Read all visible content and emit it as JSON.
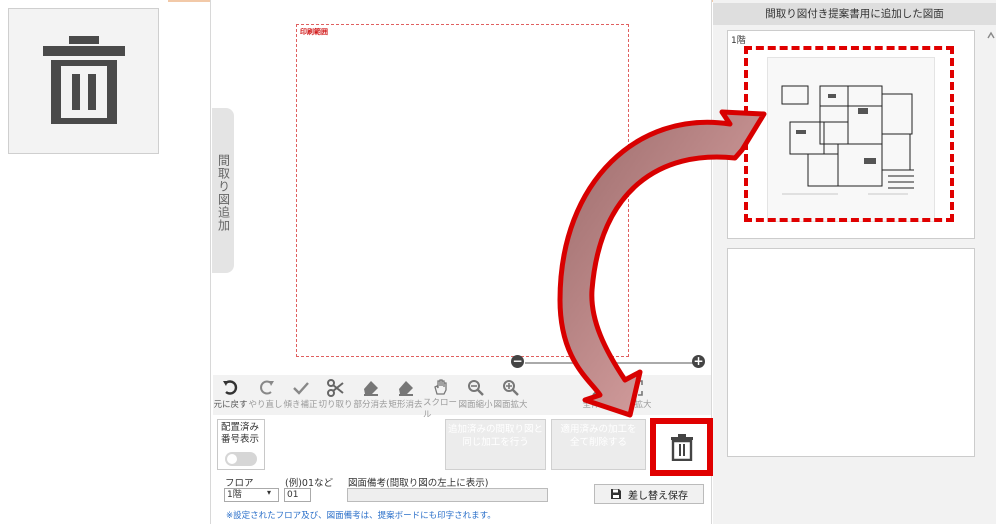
{
  "colors": {
    "highlight_red": "#e00000",
    "note_blue": "#2a6fc9",
    "print_red": "#d21a1a"
  },
  "side_tab": {
    "label": "間取り図追加"
  },
  "canvas": {
    "print_area_label": "印刷範囲"
  },
  "toolbar": {
    "items": [
      {
        "label": "元に戻す",
        "icon": "undo-icon"
      },
      {
        "label": "やり直し",
        "icon": "redo-icon"
      },
      {
        "label": "傾き補正",
        "icon": "check-icon"
      },
      {
        "label": "切り取り",
        "icon": "scissors-icon"
      },
      {
        "label": "部分消去",
        "icon": "eraser-icon"
      },
      {
        "label": "矩形消去",
        "icon": "rect-eraser-icon"
      },
      {
        "label": "スクロール",
        "icon": "hand-icon"
      },
      {
        "label": "図面縮小",
        "icon": "zoom-out-icon"
      },
      {
        "label": "図面拡大",
        "icon": "zoom-in-icon"
      },
      {
        "label": "",
        "icon": "placeholder"
      },
      {
        "label": "全体表示",
        "icon": "fit-icon"
      },
      {
        "label": "範囲拡大",
        "icon": "range-zoom-icon"
      }
    ]
  },
  "controls": {
    "number_display_line1": "配置済み",
    "number_display_line2": "番号表示",
    "apply_same_line1": "追加済みの間取り図と",
    "apply_same_line2": "同じ加工を行う",
    "delete_all_line1": "適用済みの加工を",
    "delete_all_line2": "全て削除する"
  },
  "form": {
    "floor_label": "フロア",
    "floor_value": "1階",
    "example_label": "(例)01など",
    "example_value": "01",
    "remark_label": "図面備考(間取り図の左上に表示)",
    "remark_value": "",
    "save_label": "差し替え保存",
    "note": "※設定されたフロア及び、図面備考は、提案ボードにも印字されます。"
  },
  "right_panel": {
    "header": "間取り図付き提案書用に追加した図面",
    "cards": [
      {
        "label": "1階"
      }
    ]
  }
}
